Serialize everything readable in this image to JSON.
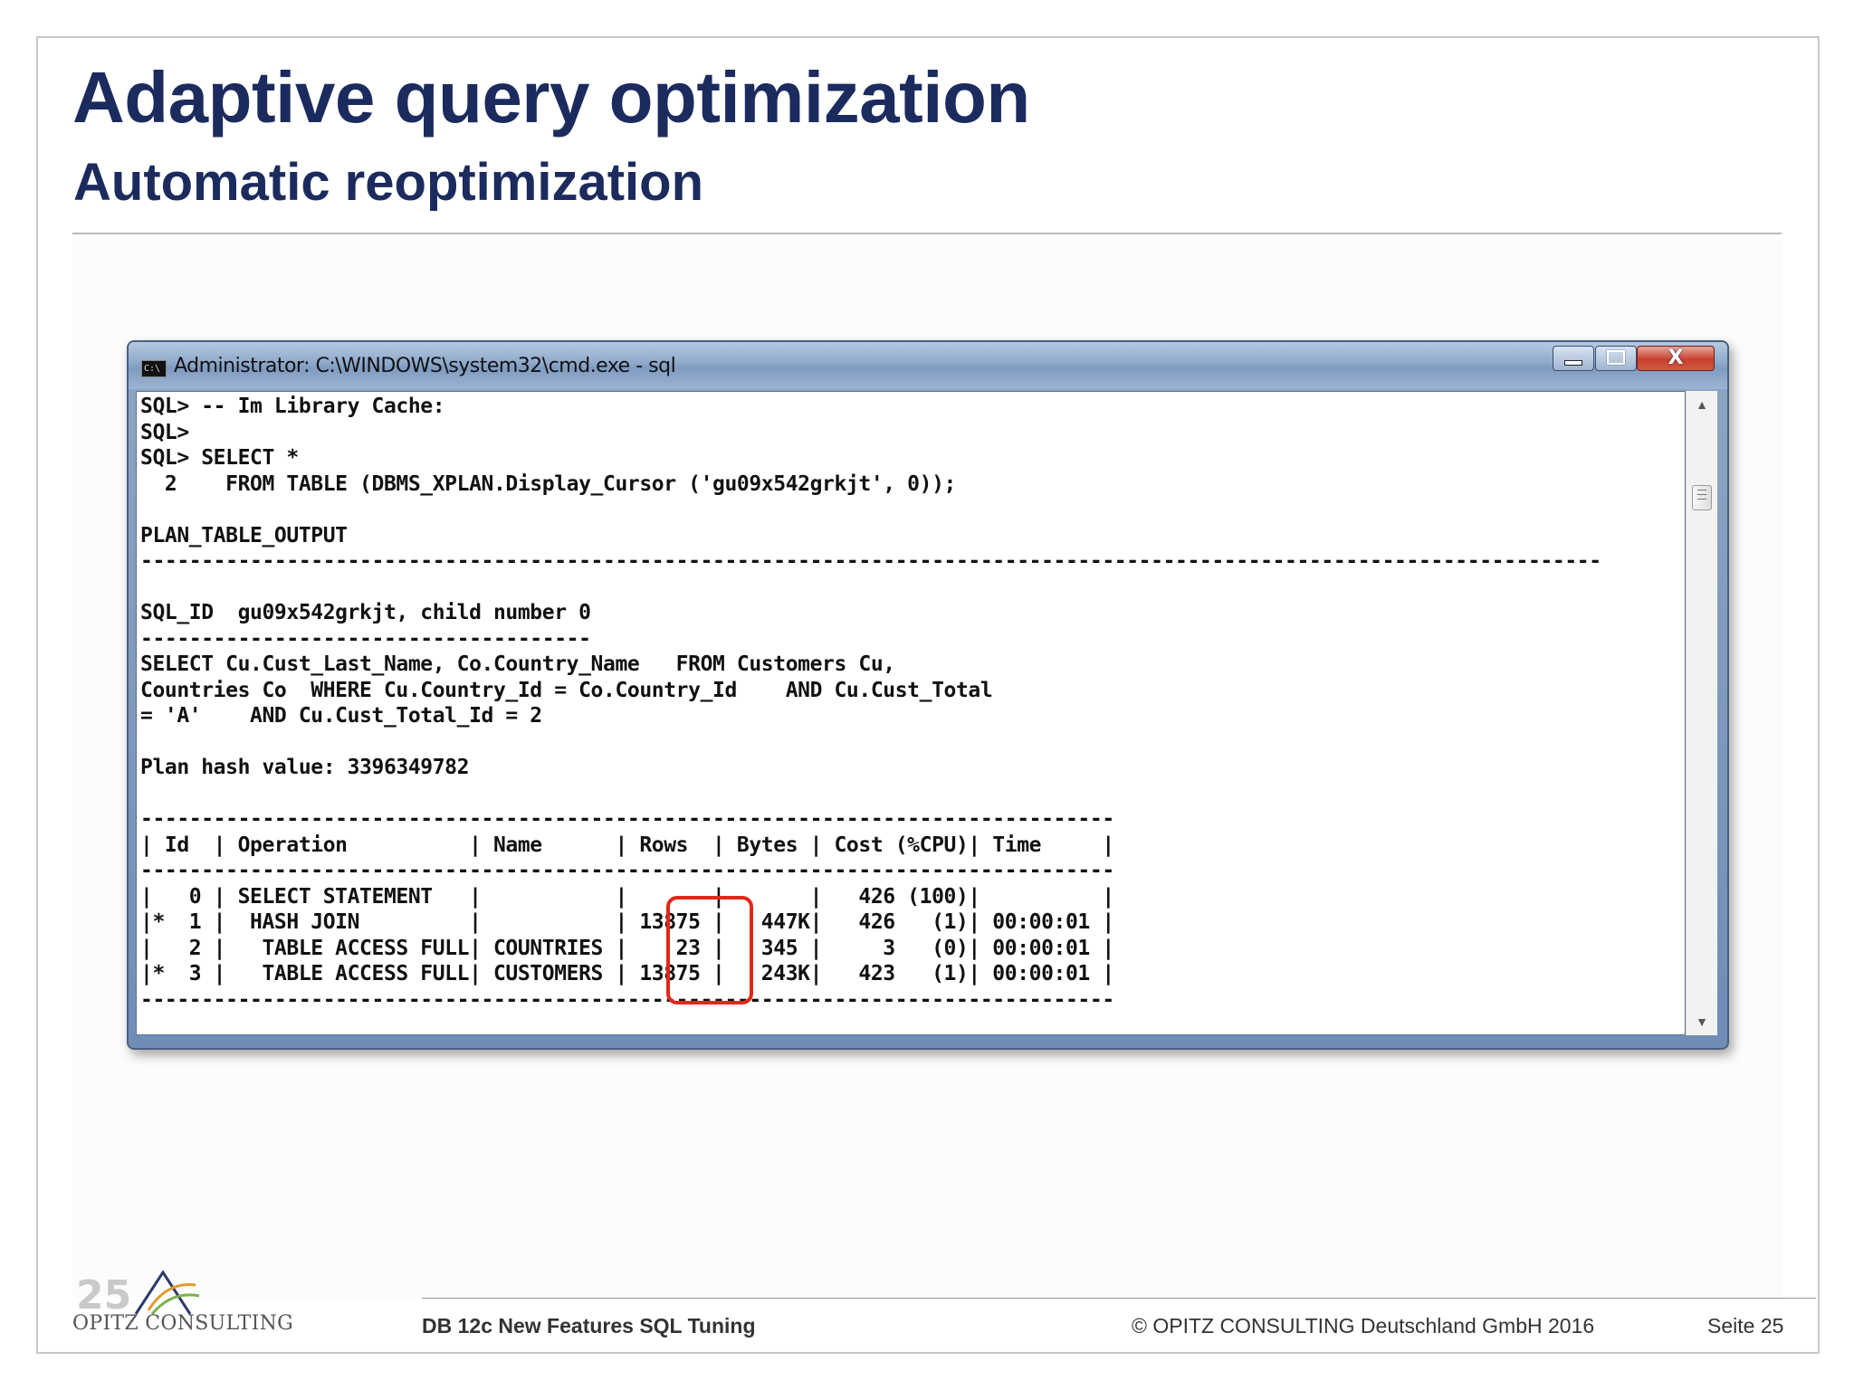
{
  "slide": {
    "title": "Adaptive query optimization",
    "subtitle": "Automatic reoptimization"
  },
  "window": {
    "title": "Administrator: C:\\WINDOWS\\system32\\cmd.exe - sql",
    "icon_text": "C:\\",
    "close_glyph": "X"
  },
  "console": {
    "lines": [
      "SQL> -- Im Library Cache:",
      "SQL>",
      "SQL> SELECT *",
      "  2    FROM TABLE (DBMS_XPLAN.Display_Cursor ('gu09x542grkjt', 0));",
      "",
      "PLAN_TABLE_OUTPUT",
      "------------------------------------------------------------------------------------------------------------------------",
      "",
      "SQL_ID  gu09x542grkjt, child number 0",
      "-------------------------------------",
      "SELECT Cu.Cust_Last_Name, Co.Country_Name   FROM Customers Cu,",
      "Countries Co  WHERE Cu.Country_Id = Co.Country_Id    AND Cu.Cust_Total",
      "= 'A'    AND Cu.Cust_Total_Id = 2",
      "",
      "Plan hash value: 3396349782",
      "",
      "--------------------------------------------------------------------------------",
      "| Id  | Operation          | Name      | Rows  | Bytes | Cost (%CPU)| Time     |",
      "--------------------------------------------------------------------------------",
      "|   0 | SELECT STATEMENT   |           |       |       |   426 (100)|          |",
      "|*  1 |  HASH JOIN         |           | 13875 |   447K|   426   (1)| 00:00:01 |",
      "|   2 |   TABLE ACCESS FULL| COUNTRIES |    23 |   345 |     3   (0)| 00:00:01 |",
      "|*  3 |   TABLE ACCESS FULL| CUSTOMERS | 13875 |   243K|   423   (1)| 00:00:01 |",
      "--------------------------------------------------------------------------------"
    ]
  },
  "scrollbar": {
    "up_glyph": "▲",
    "down_glyph": "▼"
  },
  "footer": {
    "logo_text": "OPITZ CONSULTING",
    "logo_badge": "25",
    "course": "DB 12c New Features SQL Tuning",
    "copyright": "© OPITZ CONSULTING Deutschland GmbH 2016",
    "page": "Seite 25"
  },
  "colors": {
    "title": "#1c2b5e",
    "highlight": "#e02818",
    "close_button": "#c6402e"
  }
}
